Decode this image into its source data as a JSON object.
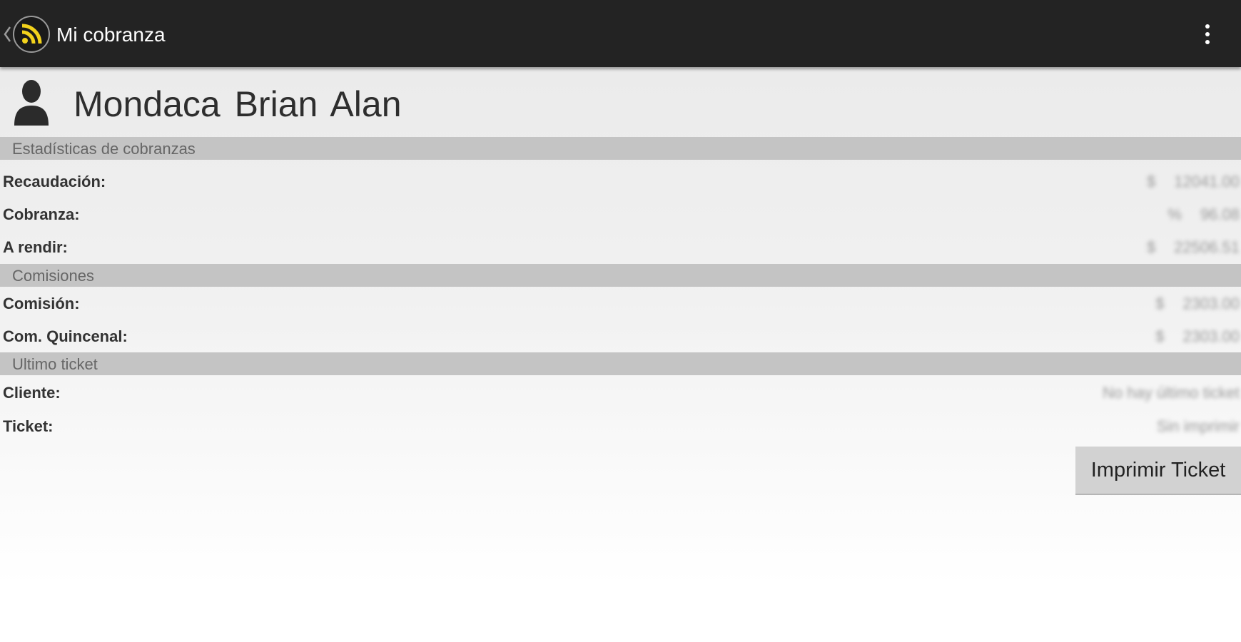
{
  "action_bar": {
    "title": "Mi cobranza",
    "logo_icon": "rss-signal-icon",
    "menu_icon": "overflow-menu-icon",
    "bar_color": "#232323",
    "accent_color": "#f2d21c"
  },
  "user": {
    "name": "Mondaca  Brian Alan",
    "icon": "user-silhouette-icon"
  },
  "sections": {
    "stats": {
      "title": "Estadísticas de cobranzas",
      "rows": [
        {
          "label": "Recaudación:",
          "unit": "$",
          "value": "12041.00"
        },
        {
          "label": "Cobranza:",
          "unit": "%",
          "value": "96.08"
        },
        {
          "label": "A rendir:",
          "unit": "$",
          "value": "22506.51"
        }
      ]
    },
    "commissions": {
      "title": "Comisiones",
      "rows": [
        {
          "label": "Comisión:",
          "unit": "$",
          "value": "2303.00"
        },
        {
          "label": "Com. Quincenal:",
          "unit": "$",
          "value": "2303.00"
        }
      ]
    },
    "last_ticket": {
      "title": "Ultimo ticket",
      "rows": [
        {
          "label": "Cliente:",
          "value": "No hay último ticket"
        },
        {
          "label": "Ticket:",
          "value": "Sin imprimir"
        }
      ]
    }
  },
  "actions": {
    "print_ticket_label": "Imprimir Ticket"
  }
}
